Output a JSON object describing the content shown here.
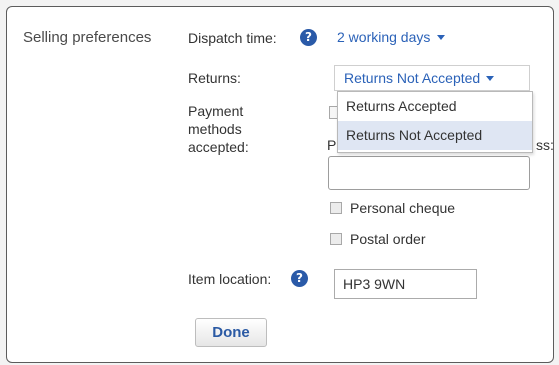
{
  "section": {
    "title": "Selling preferences"
  },
  "dispatch": {
    "label": "Dispatch time:",
    "value": "2 working days",
    "help_icon": "question-circle-icon"
  },
  "returns": {
    "label": "Returns:",
    "value": "Returns Not Accepted",
    "options": [
      "Returns Accepted",
      "Returns Not Accepted"
    ],
    "selected_index": 1
  },
  "payment": {
    "label_lines": [
      "Payment",
      "methods",
      "accepted:"
    ],
    "partial_left": "P",
    "partial_right": "ss:",
    "email_value": "",
    "options": [
      "Personal cheque",
      "Postal order"
    ]
  },
  "location": {
    "label": "Item location:",
    "value": "HP3 9WN",
    "help_icon": "question-circle-icon"
  },
  "done": {
    "label": "Done"
  },
  "colors": {
    "link": "#2b62b8",
    "help_icon": "#2a5aa8",
    "selected_option": "#dfe6f3"
  }
}
